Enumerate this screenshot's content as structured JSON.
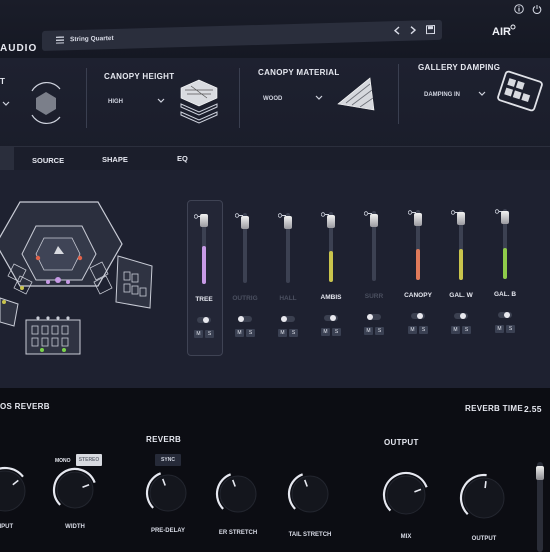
{
  "header": {
    "brand_fragment": "AUDIO",
    "preset_name": "String Quartet",
    "logo": "AIR",
    "icons": [
      "list-icon",
      "prev-icon",
      "next-icon",
      "save-icon",
      "info-icon",
      "power-icon"
    ]
  },
  "canopy": {
    "first_section_fragment": "T",
    "height": {
      "label": "CANOPY HEIGHT",
      "value": "HIGH"
    },
    "material": {
      "label": "CANOPY MATERIAL",
      "value": "WOOD"
    },
    "gallery": {
      "label": "GALLERY DAMPING",
      "value": "DAMPING IN"
    }
  },
  "tabs": [
    "SOURCE",
    "SHAPE",
    "EQ"
  ],
  "mixer": {
    "channels": [
      {
        "name": "TREE",
        "active": true,
        "fill": 0.55,
        "color": "#c79ae6",
        "fader": 0.95
      },
      {
        "name": "OUTRIG",
        "active": false,
        "fill": 0.0,
        "color": "#5a6070",
        "fader": 0.9
      },
      {
        "name": "HALL",
        "active": false,
        "fill": 0.0,
        "color": "#5a6070",
        "fader": 0.9
      },
      {
        "name": "AMBIS",
        "active": true,
        "fill": 0.45,
        "color": "#c9c44c",
        "fader": 0.9
      },
      {
        "name": "SURR",
        "active": false,
        "fill": 0.0,
        "color": "#5a6070",
        "fader": 0.9
      },
      {
        "name": "CANOPY",
        "active": true,
        "fill": 0.45,
        "color": "#e07a5a",
        "fader": 0.9
      },
      {
        "name": "GAL. W",
        "active": true,
        "fill": 0.45,
        "color": "#c9c44c",
        "fader": 0.92
      },
      {
        "name": "GAL. B",
        "active": true,
        "fill": 0.45,
        "color": "#8fcc4a",
        "fader": 0.92
      }
    ],
    "mute_label": "M",
    "solo_label": "S"
  },
  "reverb_panel": {
    "section_title_fragment": "OS REVERB",
    "reverb_time_label": "REVERB TIME",
    "reverb_time_value": "2.55",
    "mode_mono": "MONO",
    "mode_stereo": "STEREO",
    "reverb_group": "REVERB",
    "sync_label": "SYNC",
    "output_group": "OUTPUT",
    "knobs": [
      "INPUT",
      "WIDTH",
      "PRE-DELAY",
      "ER STRETCH",
      "TAIL STRETCH",
      "MIX",
      "OUTPUT"
    ],
    "input_fragment": "NPUT"
  },
  "colors": {
    "accent_purple": "#c79ae6",
    "led_green": "#7ad24a",
    "led_red": "#e0624a"
  }
}
